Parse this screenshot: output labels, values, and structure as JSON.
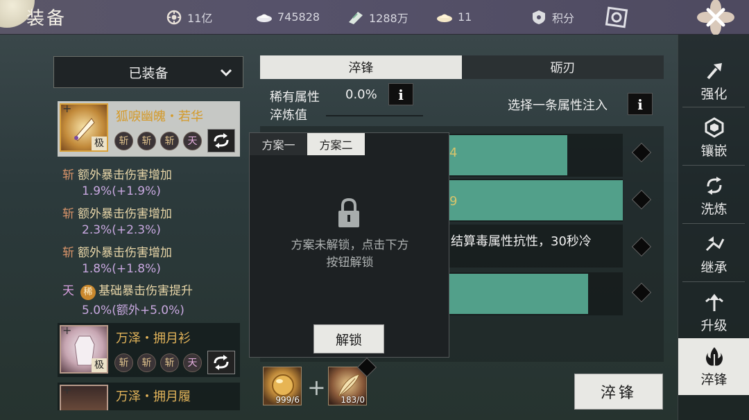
{
  "header": {
    "title": "装备",
    "resources": [
      {
        "icon": "coin-gear-icon",
        "value": "11亿"
      },
      {
        "icon": "silver-ingot-icon",
        "value": "745828"
      },
      {
        "icon": "jade-ticket-icon",
        "value": "1288万"
      },
      {
        "icon": "gold-ingot-icon",
        "value": "11"
      }
    ],
    "points_label": "积分",
    "close_icon": "close-icon"
  },
  "equipment": {
    "dropdown_label": "已装备",
    "items": [
      {
        "name": "狐唳幽魄・若华",
        "grade": "极",
        "plus": "+",
        "badges": [
          "斩",
          "斩",
          "斩",
          "天"
        ],
        "stats": [
          {
            "tag": "斩",
            "label": "额外暴击伤害增加",
            "value": "1.9%(+1.9%)"
          },
          {
            "tag": "斩",
            "label": "额外暴击伤害增加",
            "value": "2.3%(+2.3%)"
          },
          {
            "tag": "斩",
            "label": "额外暴击伤害增加",
            "value": "1.8%(+1.8%)"
          },
          {
            "tag": "天",
            "extra": "稀",
            "label": "基础暴击伤害提升",
            "value": "5.0%(额外+5.0%)"
          }
        ]
      },
      {
        "name": "万泽・拥月衫",
        "grade": "极",
        "plus": "+",
        "badges": [
          "斩",
          "斩",
          "斩",
          "天"
        ]
      },
      {
        "name": "万泽・拥月履",
        "plus": "+"
      }
    ]
  },
  "tabs": {
    "active": "淬锋",
    "inactive": "砺刃"
  },
  "rare": {
    "label_line1": "稀有属性",
    "label_line2": "淬炼值",
    "value": "0.0%",
    "info": "i"
  },
  "select_hint": "选择一条属性注入",
  "attributes": {
    "bars": [
      {
        "fragment": "4",
        "fill": 0.68
      },
      {
        "fragment": "9",
        "fill": 1.0
      },
      {
        "fragment": "结算毒属性抗性，30秒冷",
        "fill": 0
      },
      {
        "fragment": "",
        "fill": 0.8
      }
    ]
  },
  "popup": {
    "tab1": "方案一",
    "tab2": "方案二",
    "message_line1": "方案未解锁，点击下方",
    "message_line2": "按钮解锁",
    "unlock_label": "解锁"
  },
  "materials": [
    {
      "icon": "gold-orb-icon",
      "count": "999/6"
    },
    {
      "icon": "feather-scroll-icon",
      "count": "183/0"
    }
  ],
  "confirm_label": "淬锋",
  "sidebar": [
    {
      "label": "强化",
      "icon": "hammer-icon"
    },
    {
      "label": "镶嵌",
      "icon": "gem-icon"
    },
    {
      "label": "洗炼",
      "icon": "refresh-icon"
    },
    {
      "label": "继承",
      "icon": "inherit-icon"
    },
    {
      "label": "升级",
      "icon": "upgrade-icon"
    },
    {
      "label": "淬锋",
      "icon": "flame-icon",
      "active": true
    }
  ],
  "colors": {
    "accent_teal": "#52a08a",
    "gold_text": "#e3b45a",
    "purple_text": "#c8a8e0"
  }
}
